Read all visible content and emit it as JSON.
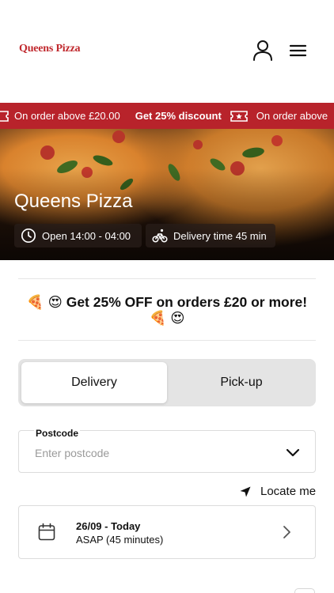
{
  "header": {
    "logo": "Queens Pizza"
  },
  "promo_bar": {
    "items": [
      "On order above £20.00",
      "Get 25% discount",
      "On order above"
    ],
    "bg_color": "#b8232b"
  },
  "hero": {
    "title": "Queens Pizza",
    "open_hours": "Open 14:00 - 04:00",
    "delivery_time": "Delivery time 45 min"
  },
  "offer": {
    "text": "Get 25% OFF on orders £20 or more!",
    "emoji_pizza": "🍕",
    "emoji_heart_eyes": "😍"
  },
  "order_mode": {
    "tabs": [
      {
        "label": "Delivery",
        "selected": true
      },
      {
        "label": "Pick-up",
        "selected": false
      }
    ]
  },
  "postcode": {
    "label": "Postcode",
    "placeholder": "Enter postcode",
    "value": ""
  },
  "locate": {
    "label": "Locate me"
  },
  "schedule": {
    "date": "26/09 - Today",
    "time": "ASAP (45 minutes)"
  },
  "icons": {
    "user": "user-icon",
    "menu": "menu-icon",
    "ticket": "ticket-icon",
    "clock": "clock-icon",
    "bike": "bike-icon",
    "location": "location-arrow-icon",
    "calendar": "calendar-icon",
    "chevron_down": "chevron-down-icon",
    "chevron_right": "chevron-right-icon"
  }
}
